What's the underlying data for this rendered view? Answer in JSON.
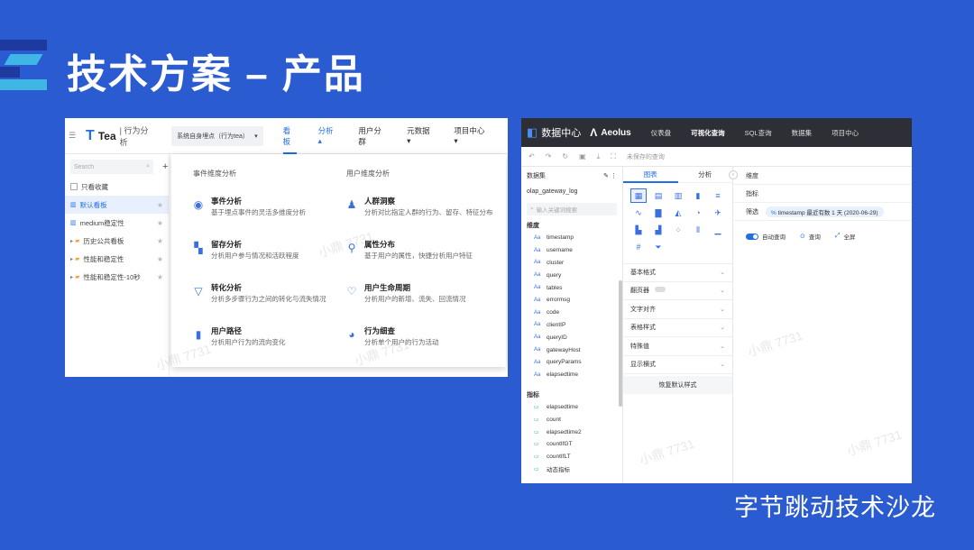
{
  "slide": {
    "title": "技术方案 – 产品",
    "footer": "字节跳动技术沙龙",
    "watermark": "小鼎 7731"
  },
  "tea": {
    "logo_name": "Tea",
    "logo_sub": "| 行为分析",
    "project_select": "系统自身埋点（行为tea）",
    "nav": [
      {
        "label": "看板"
      },
      {
        "label": "分析 ▴"
      },
      {
        "label": "用户分群"
      },
      {
        "label": "元数据 ▾"
      },
      {
        "label": "项目中心 ▾"
      }
    ],
    "sidebar": {
      "search_placeholder": "Search",
      "favorites_label": "只看收藏",
      "items": [
        {
          "label": "默认看板"
        },
        {
          "label": "medium稳定性"
        },
        {
          "label": "历史公共看板"
        },
        {
          "label": "性能和稳定性"
        },
        {
          "label": "性能和稳定性-10秒"
        }
      ]
    },
    "dropdown": {
      "event_header": "事件维度分析",
      "user_header": "用户维度分析",
      "event_items": [
        {
          "title": "事件分析",
          "desc": "基于埋点事件的灵活多维度分析"
        },
        {
          "title": "留存分析",
          "desc": "分析用户参与情况和活跃程度"
        },
        {
          "title": "转化分析",
          "desc": "分析多步骤行为之间的转化与流失情况"
        },
        {
          "title": "用户路径",
          "desc": "分析用户行为的流向变化"
        }
      ],
      "user_items": [
        {
          "title": "人群洞察",
          "desc": "分析对比指定人群的行为、留存、特征分布"
        },
        {
          "title": "属性分布",
          "desc": "基于用户的属性，快捷分析用户特征"
        },
        {
          "title": "用户生命周期",
          "desc": "分析用户的新增、流失、回流情况"
        },
        {
          "title": "行为细查",
          "desc": "分析单个用户的行为活动"
        }
      ]
    }
  },
  "aeolus": {
    "logo1_text": "数据中心",
    "logo2_text": "Aeolus",
    "nav": [
      {
        "label": "仪表盘"
      },
      {
        "label": "可视化查询"
      },
      {
        "label": "SQL查询"
      },
      {
        "label": "数据集"
      },
      {
        "label": "项目中心"
      }
    ],
    "toolbar_unsaved": "未保存的查询",
    "dataset_header": "数据集",
    "dataset_name": "olap_gateway_log",
    "search_placeholder": "输入关键词搜索",
    "dimension_label": "维度",
    "dimensions": [
      "timestamp",
      "username",
      "cluster",
      "query",
      "tables",
      "errormsg",
      "code",
      "clientIP",
      "queryID",
      "gatewayHost",
      "queryParams",
      "elapsedtime"
    ],
    "metric_label": "指标",
    "metrics": [
      "elapsedtime",
      "count",
      "elapsedtime2",
      "countIfGT",
      "countIfLT",
      "动态指标"
    ],
    "tabs": [
      {
        "label": "图表"
      },
      {
        "label": "分析"
      }
    ],
    "style_rows": [
      {
        "label": "基本格式"
      },
      {
        "label": "翻页器"
      },
      {
        "label": "文字对齐"
      },
      {
        "label": "表格样式"
      },
      {
        "label": "特殊值"
      },
      {
        "label": "显示横式"
      }
    ],
    "reset_label": "恢复默认样式",
    "right": {
      "dimension_label": "维度",
      "metric_label": "指标",
      "filter_label": "筛选",
      "filter_chip": "timestamp 最近有数 1 天 (2020-06-29)",
      "auto_query": "自动查询",
      "query": "查询",
      "fullscreen": "全屏"
    }
  }
}
